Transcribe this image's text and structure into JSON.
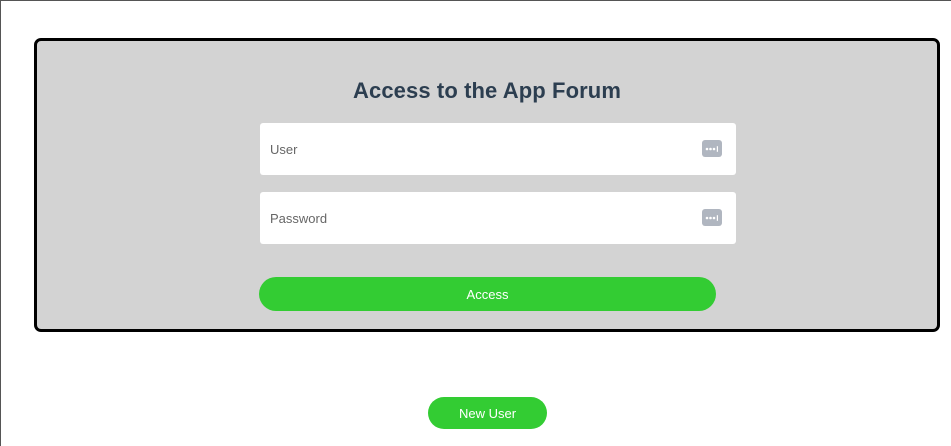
{
  "login": {
    "title": "Access to the App Forum",
    "user_field": {
      "placeholder": "User",
      "value": "",
      "icon": "password-manager-icon"
    },
    "password_field": {
      "placeholder": "Password",
      "value": "",
      "icon": "password-manager-icon"
    },
    "access_label": "Access"
  },
  "footer": {
    "new_user_label": "New User"
  },
  "colors": {
    "panel_background": "#d3d3d3",
    "panel_border": "#000000",
    "title": "#2c3e50",
    "button": "#33cc33",
    "button_text": "#ffffff",
    "icon_background": "#b0b6c0"
  }
}
